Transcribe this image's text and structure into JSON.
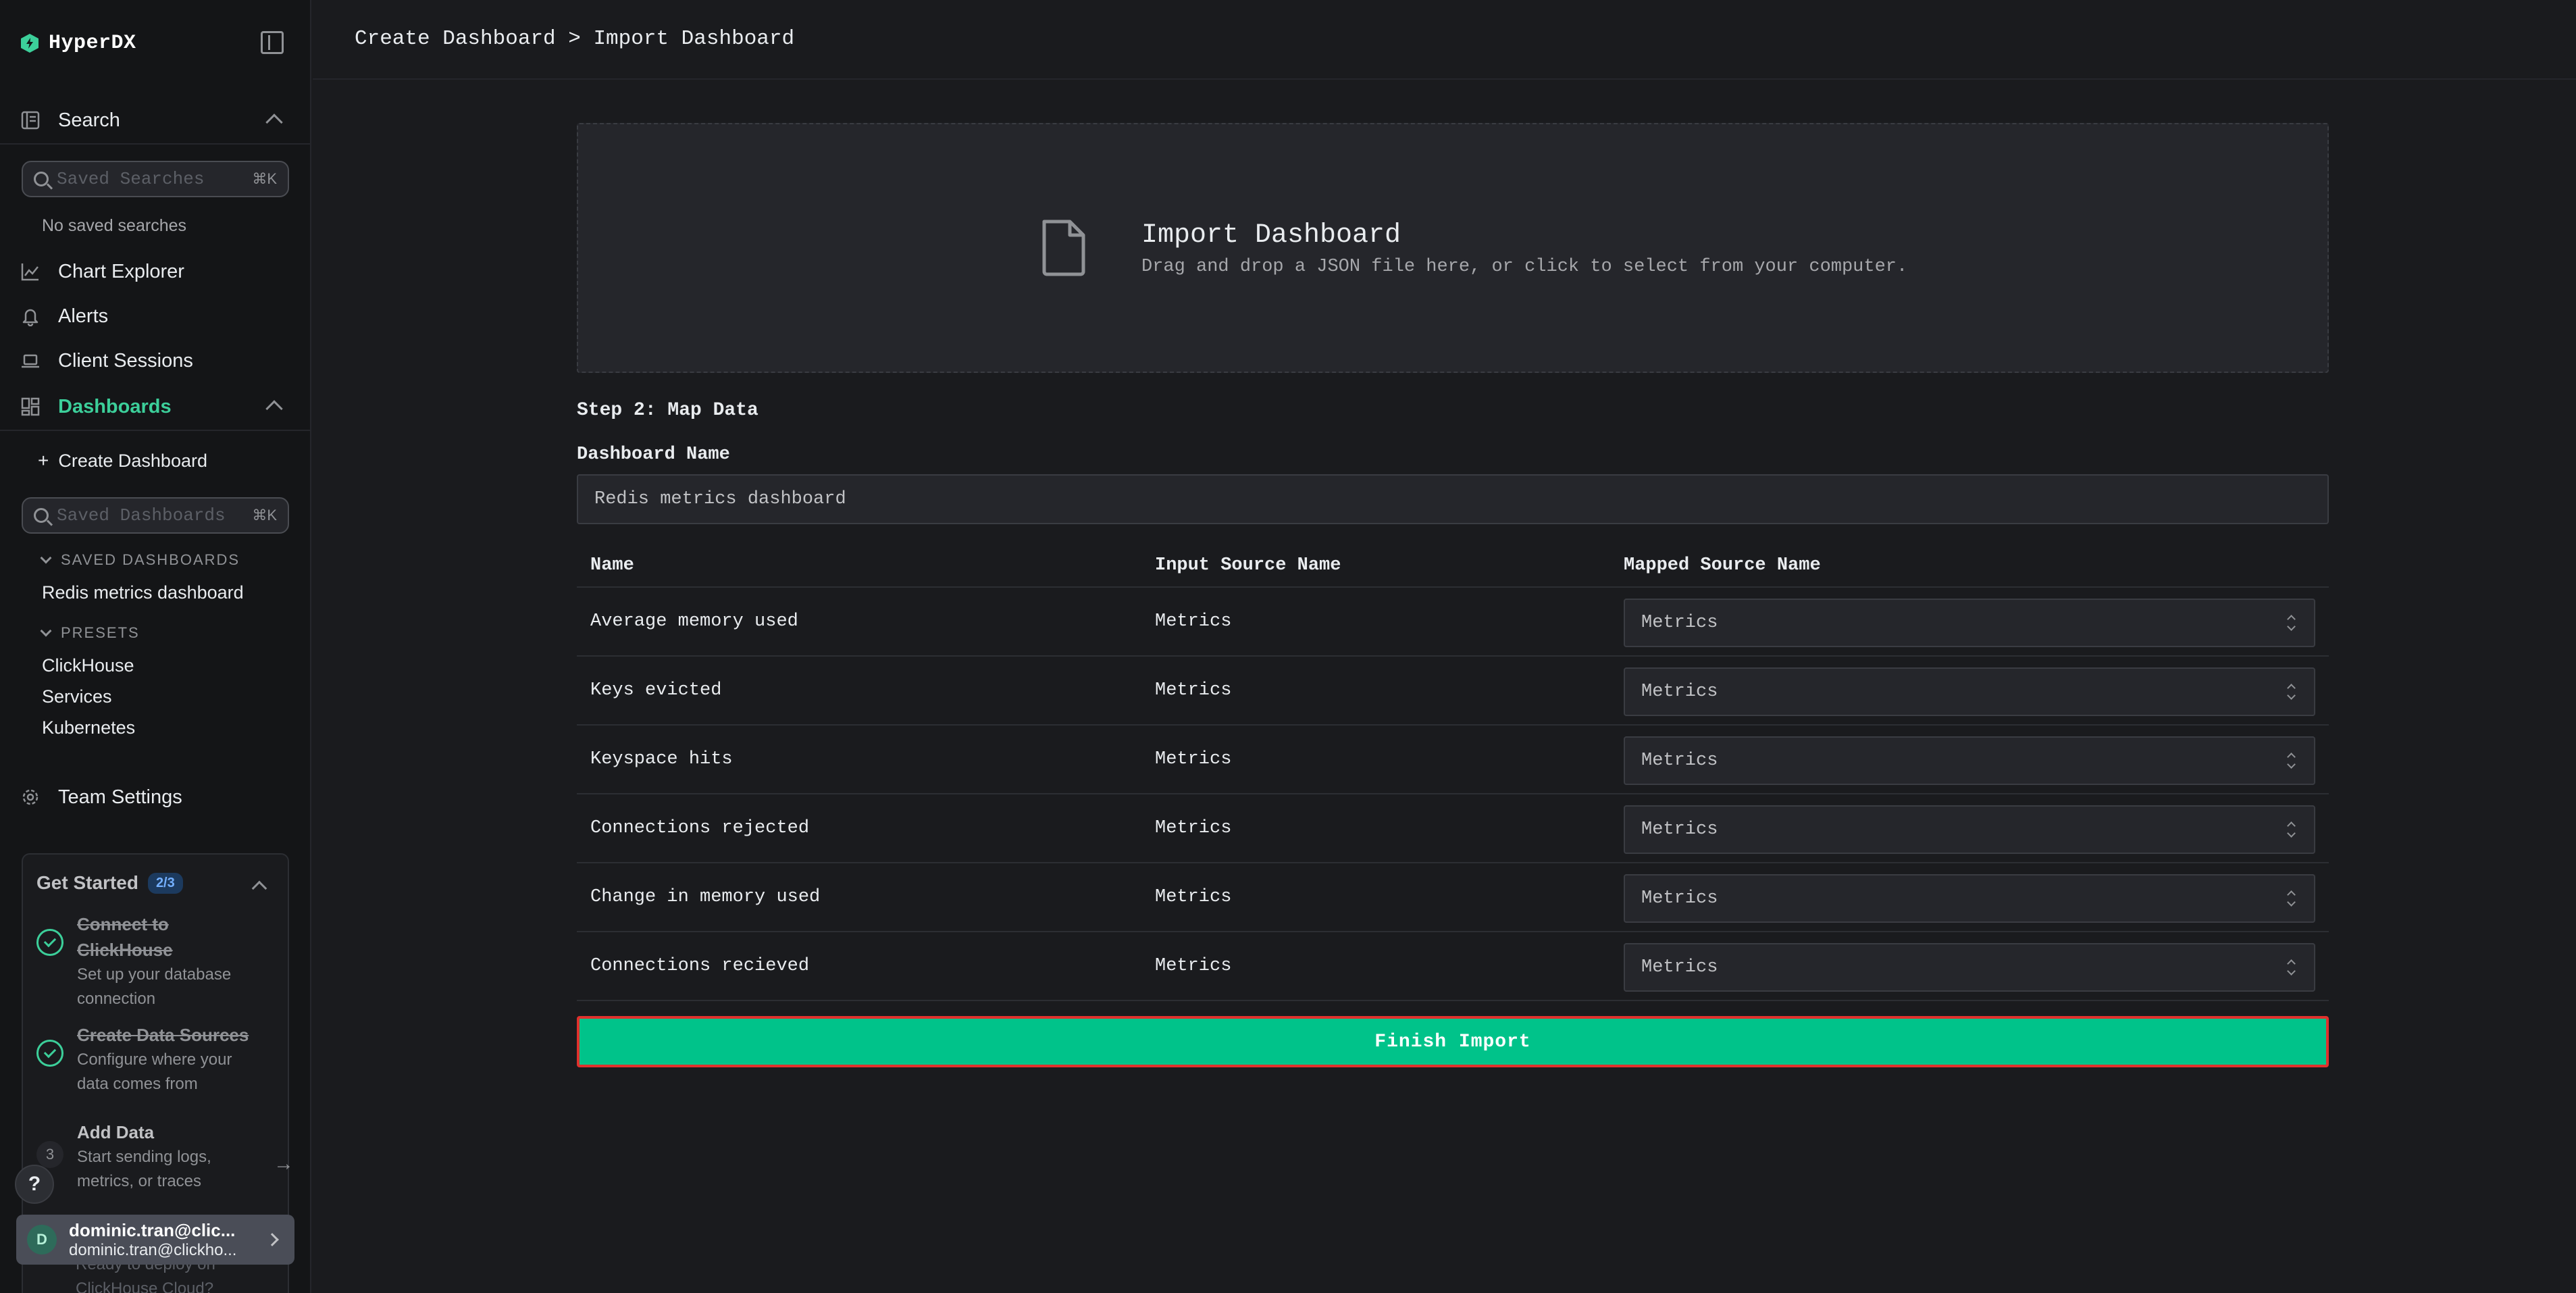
{
  "app": {
    "name": "HyperDX"
  },
  "colors": {
    "accent": "#00c38a",
    "active_nav": "#3ccf9a",
    "highlight_border": "#e0312d"
  },
  "sidebar": {
    "search": {
      "label": "Search",
      "placeholder": "Saved Searches",
      "shortcut": "⌘K",
      "empty_text": "No saved searches"
    },
    "nav": {
      "chart_explorer": "Chart Explorer",
      "alerts": "Alerts",
      "client_sessions": "Client Sessions",
      "dashboards": "Dashboards",
      "team_settings": "Team Settings"
    },
    "dashboards": {
      "create": "Create Dashboard",
      "placeholder": "Saved Dashboards",
      "shortcut": "⌘K",
      "saved_header": "SAVED DASHBOARDS",
      "saved": [
        "Redis metrics dashboard"
      ],
      "presets_header": "PRESETS",
      "presets": [
        "ClickHouse",
        "Services",
        "Kubernetes"
      ]
    },
    "get_started": {
      "title": "Get Started",
      "progress": "2/3",
      "steps": [
        {
          "title": "Connect to ClickHouse",
          "desc": "Set up your database connection",
          "done": true
        },
        {
          "title": "Create Data Sources",
          "desc": "Configure where your data comes from",
          "done": true
        },
        {
          "number": "3",
          "title": "Add Data",
          "desc": "Start sending logs, metrics, or traces",
          "done": false
        }
      ],
      "faded_line_1": "Ready to deploy on",
      "faded_line_2": "ClickHouse Cloud?"
    },
    "help_label": "?",
    "user": {
      "initial": "D",
      "name": "dominic.tran@clic...",
      "email": "dominic.tran@clickho..."
    }
  },
  "breadcrumb": "Create Dashboard > Import Dashboard",
  "dropzone": {
    "title": "Import Dashboard",
    "subtitle": "Drag and drop a JSON file here, or click to select from your computer."
  },
  "form": {
    "step_label": "Step 2: Map Data",
    "name_label": "Dashboard Name",
    "name_value": "Redis metrics dashboard",
    "columns": [
      "Name",
      "Input Source Name",
      "Mapped Source Name"
    ],
    "rows": [
      {
        "name": "Average memory used",
        "input": "Metrics",
        "mapped": "Metrics"
      },
      {
        "name": "Keys evicted",
        "input": "Metrics",
        "mapped": "Metrics"
      },
      {
        "name": "Keyspace hits",
        "input": "Metrics",
        "mapped": "Metrics"
      },
      {
        "name": "Connections rejected",
        "input": "Metrics",
        "mapped": "Metrics"
      },
      {
        "name": "Change in memory used",
        "input": "Metrics",
        "mapped": "Metrics"
      },
      {
        "name": "Connections recieved",
        "input": "Metrics",
        "mapped": "Metrics"
      }
    ],
    "submit_label": "Finish Import"
  }
}
